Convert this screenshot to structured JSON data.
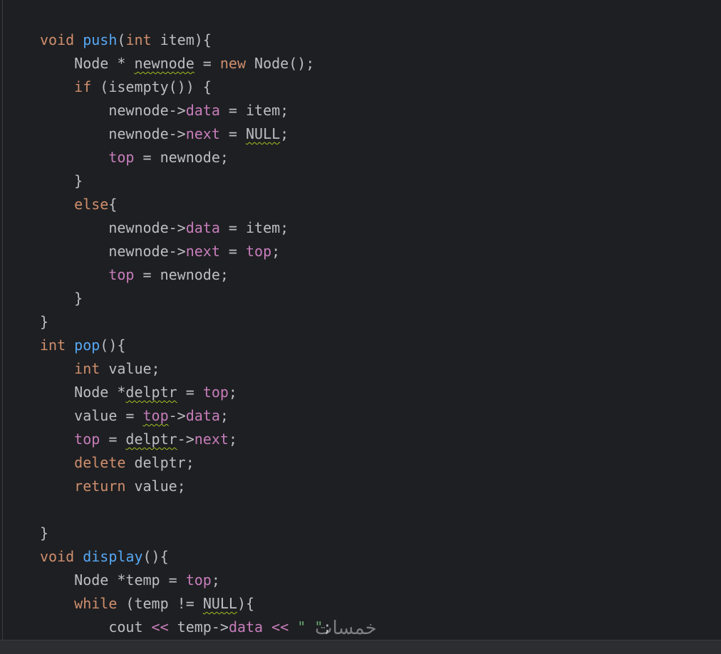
{
  "editor": {
    "lines": [
      [
        {
          "t": "void",
          "c": "kw"
        },
        {
          "t": " "
        },
        {
          "t": "push",
          "c": "fn"
        },
        {
          "t": "("
        },
        {
          "t": "int",
          "c": "kw"
        },
        {
          "t": " item){"
        }
      ],
      [
        {
          "t": "    Node * "
        },
        {
          "t": "newnode",
          "c": "squig"
        },
        {
          "t": " = "
        },
        {
          "t": "new",
          "c": "kw"
        },
        {
          "t": " Node();"
        }
      ],
      [
        {
          "t": "    "
        },
        {
          "t": "if",
          "c": "kw"
        },
        {
          "t": " (isempty()) {"
        }
      ],
      [
        {
          "t": "        newnode->"
        },
        {
          "t": "data",
          "c": "fld"
        },
        {
          "t": " = item;"
        }
      ],
      [
        {
          "t": "        newnode->"
        },
        {
          "t": "next",
          "c": "fld"
        },
        {
          "t": " = "
        },
        {
          "t": "NULL",
          "c": "squig"
        },
        {
          "t": ";"
        }
      ],
      [
        {
          "t": "        "
        },
        {
          "t": "top",
          "c": "fld"
        },
        {
          "t": " = newnode;"
        }
      ],
      [
        {
          "t": "    }"
        }
      ],
      [
        {
          "t": "    "
        },
        {
          "t": "else",
          "c": "kw"
        },
        {
          "t": "{"
        }
      ],
      [
        {
          "t": "        newnode->"
        },
        {
          "t": "data",
          "c": "fld"
        },
        {
          "t": " = item;"
        }
      ],
      [
        {
          "t": "        newnode->"
        },
        {
          "t": "next",
          "c": "fld"
        },
        {
          "t": " = "
        },
        {
          "t": "top",
          "c": "fld"
        },
        {
          "t": ";"
        }
      ],
      [
        {
          "t": "        "
        },
        {
          "t": "top",
          "c": "fld"
        },
        {
          "t": " = newnode;"
        }
      ],
      [
        {
          "t": "    }"
        }
      ],
      [
        {
          "t": "}"
        }
      ],
      [
        {
          "t": "int",
          "c": "kw"
        },
        {
          "t": " "
        },
        {
          "t": "pop",
          "c": "fn"
        },
        {
          "t": "(){"
        }
      ],
      [
        {
          "t": "    "
        },
        {
          "t": "int",
          "c": "kw"
        },
        {
          "t": " value;"
        }
      ],
      [
        {
          "t": "    Node *"
        },
        {
          "t": "delptr",
          "c": "squig"
        },
        {
          "t": " = "
        },
        {
          "t": "top",
          "c": "fld"
        },
        {
          "t": ";"
        }
      ],
      [
        {
          "t": "    value = "
        },
        {
          "t": "top",
          "c": "fld squig"
        },
        {
          "t": "->"
        },
        {
          "t": "data",
          "c": "fld"
        },
        {
          "t": ";"
        }
      ],
      [
        {
          "t": "    "
        },
        {
          "t": "top",
          "c": "fld"
        },
        {
          "t": " = "
        },
        {
          "t": "delptr",
          "c": "squig"
        },
        {
          "t": "->"
        },
        {
          "t": "next",
          "c": "fld"
        },
        {
          "t": ";"
        }
      ],
      [
        {
          "t": "    "
        },
        {
          "t": "delete",
          "c": "kw"
        },
        {
          "t": " delptr;"
        }
      ],
      [
        {
          "t": "    "
        },
        {
          "t": "return",
          "c": "kw"
        },
        {
          "t": " value;"
        }
      ],
      [],
      [
        {
          "t": "}"
        }
      ],
      [
        {
          "t": "void",
          "c": "kw"
        },
        {
          "t": " "
        },
        {
          "t": "display",
          "c": "fn"
        },
        {
          "t": "(){"
        }
      ],
      [
        {
          "t": "    Node *temp = "
        },
        {
          "t": "top",
          "c": "fld"
        },
        {
          "t": ";"
        }
      ],
      [
        {
          "t": "    "
        },
        {
          "t": "while",
          "c": "kw"
        },
        {
          "t": " (temp != "
        },
        {
          "t": "NULL",
          "c": "squig"
        },
        {
          "t": "){"
        }
      ],
      [
        {
          "t": "        cout "
        },
        {
          "t": "<<",
          "c": "fld"
        },
        {
          "t": " temp->"
        },
        {
          "t": "data",
          "c": "fld"
        },
        {
          "t": " "
        },
        {
          "t": "<<",
          "c": "fld"
        },
        {
          "t": " "
        },
        {
          "t": "\" \"",
          "c": "str"
        },
        {
          "t": ";"
        }
      ]
    ]
  },
  "watermark": "خمسات"
}
